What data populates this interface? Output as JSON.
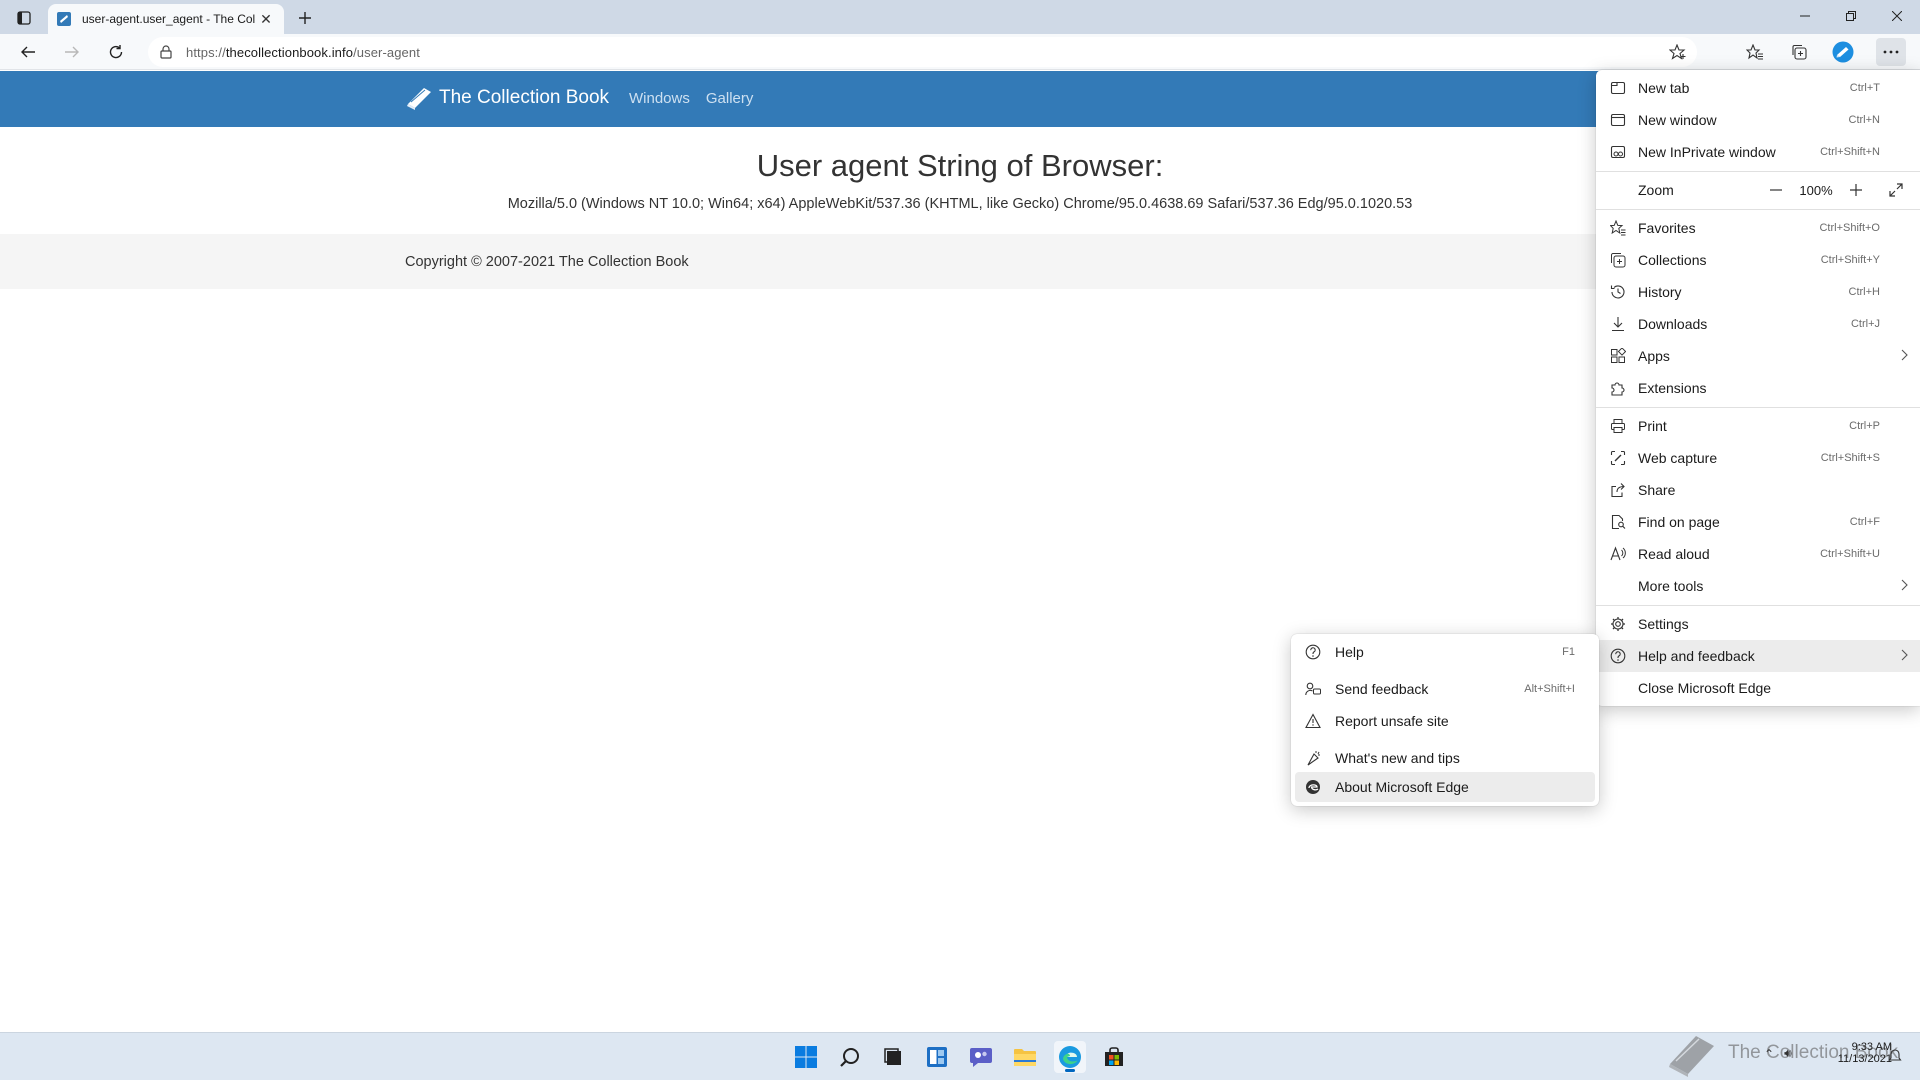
{
  "browser": {
    "tab_title": "user-agent.user_agent - The Coll",
    "url_prefix": "https://",
    "url_host": "thecollectionbook.info",
    "url_path": "/user-agent"
  },
  "site": {
    "brand": "The Collection Book",
    "nav": [
      "Windows",
      "Gallery"
    ],
    "title": "User agent String of Browser:",
    "user_agent": "Mozilla/5.0 (Windows NT 10.0; Win64; x64) AppleWebKit/537.36 (KHTML, like Gecko) Chrome/95.0.4638.69 Safari/537.36 Edg/95.0.1020.53",
    "copyright": "Copyright © 2007-2021 The Collection Book"
  },
  "menu": {
    "new_tab": {
      "label": "New tab",
      "shortcut": "Ctrl+T"
    },
    "new_window": {
      "label": "New window",
      "shortcut": "Ctrl+N"
    },
    "new_inprivate": {
      "label": "New InPrivate window",
      "shortcut": "Ctrl+Shift+N"
    },
    "zoom": {
      "label": "Zoom",
      "minus": "—",
      "value": "100%",
      "plus": "+"
    },
    "favorites": {
      "label": "Favorites",
      "shortcut": "Ctrl+Shift+O"
    },
    "collections": {
      "label": "Collections",
      "shortcut": "Ctrl+Shift+Y"
    },
    "history": {
      "label": "History",
      "shortcut": "Ctrl+H"
    },
    "downloads": {
      "label": "Downloads",
      "shortcut": "Ctrl+J"
    },
    "apps": {
      "label": "Apps"
    },
    "extensions": {
      "label": "Extensions"
    },
    "print": {
      "label": "Print",
      "shortcut": "Ctrl+P"
    },
    "web_capture": {
      "label": "Web capture",
      "shortcut": "Ctrl+Shift+S"
    },
    "share": {
      "label": "Share"
    },
    "find_on_page": {
      "label": "Find on page",
      "shortcut": "Ctrl+F"
    },
    "read_aloud": {
      "label": "Read aloud",
      "shortcut": "Ctrl+Shift+U"
    },
    "more_tools": {
      "label": "More tools"
    },
    "settings": {
      "label": "Settings"
    },
    "help_feedback": {
      "label": "Help and feedback"
    },
    "close_edge": {
      "label": "Close Microsoft Edge"
    }
  },
  "submenu": {
    "help": {
      "label": "Help",
      "shortcut": "F1"
    },
    "send_feedback": {
      "label": "Send feedback",
      "shortcut": "Alt+Shift+I"
    },
    "report_unsafe": {
      "label": "Report unsafe site"
    },
    "whats_new": {
      "label": "What's new and tips"
    },
    "about": {
      "label": "About Microsoft Edge"
    }
  },
  "taskbar": {
    "watermark": "The Collection Book",
    "time": "9:33 AM",
    "date": "11/13/2021"
  },
  "colors": {
    "site_header": "#337ab7",
    "accent": "#0067c0",
    "tabstrip": "#cfd9e6"
  }
}
